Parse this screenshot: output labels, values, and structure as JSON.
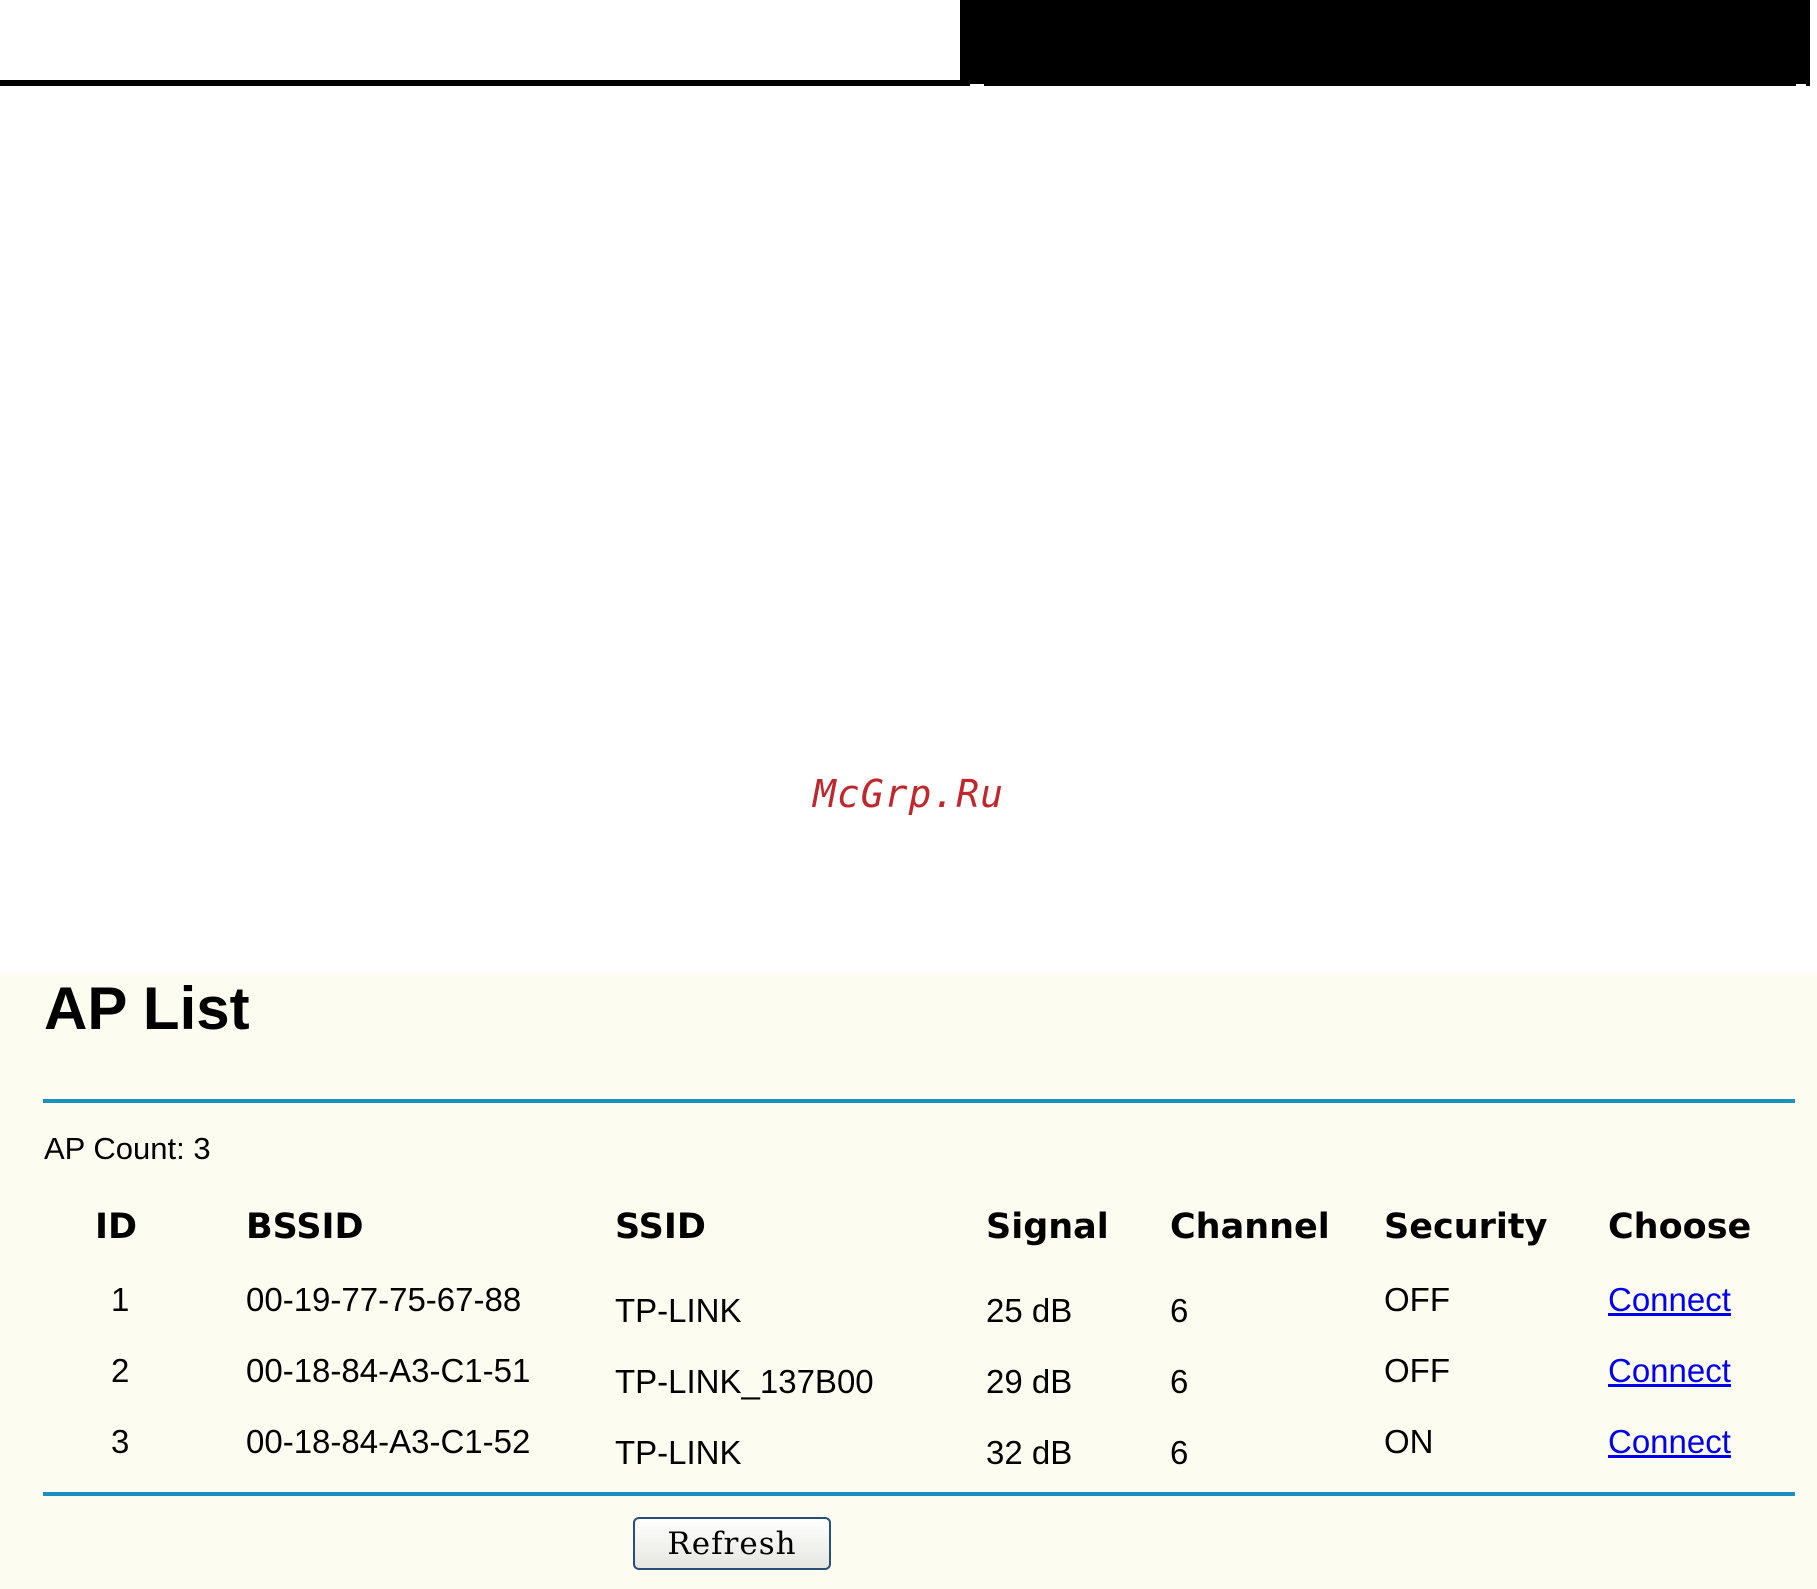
{
  "watermark": "McGrp.Ru",
  "page": {
    "title": "AP List",
    "ap_count_label": "AP Count:",
    "ap_count_value": "3"
  },
  "table": {
    "headers": {
      "id": "ID",
      "bssid": "BSSID",
      "ssid": "SSID",
      "signal": "Signal",
      "channel": "Channel",
      "security": "Security",
      "choose": "Choose"
    },
    "rows": [
      {
        "id": "1",
        "bssid": "00-19-77-75-67-88",
        "ssid": "TP-LINK",
        "signal": "25 dB",
        "channel": "6",
        "security": "OFF",
        "action": "Connect"
      },
      {
        "id": "2",
        "bssid": "00-18-84-A3-C1-51",
        "ssid": "TP-LINK_137B00",
        "signal": "29 dB",
        "channel": "6",
        "security": "OFF",
        "action": "Connect"
      },
      {
        "id": "3",
        "bssid": "00-18-84-A3-C1-52",
        "ssid": "TP-LINK",
        "signal": "32 dB",
        "channel": "6",
        "security": "ON",
        "action": "Connect"
      }
    ]
  },
  "buttons": {
    "refresh": "Refresh"
  },
  "colors": {
    "panel_background": "#fcfcf0",
    "rule": "#1a8fc1",
    "link": "#0000ee",
    "watermark": "#c0272d"
  }
}
